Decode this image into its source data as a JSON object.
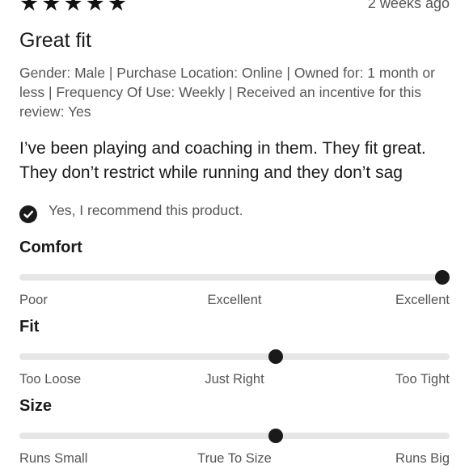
{
  "review": {
    "stars": [
      "★",
      "★",
      "★",
      "★",
      "★"
    ],
    "rating": 5,
    "date": "2 weeks ago",
    "title": "Great fit",
    "meta": "Gender: Male | Purchase Location: Online | Owned for: 1 month or less | Frequency Of Use: Weekly | Received an incentive for this review: Yes",
    "body_line1": "I’ve been playing and coaching in them. They fit great.",
    "body_line2": "They don’t restrict while running and they don’t sag",
    "recommend": "Yes, I recommend this product."
  },
  "factors": [
    {
      "name": "Comfort",
      "value": 1.0,
      "labels": [
        "Poor",
        "Excellent",
        "Excellent"
      ]
    },
    {
      "name": "Fit",
      "value": 0.6,
      "labels": [
        "Too Loose",
        "Just Right",
        "Too Tight"
      ]
    },
    {
      "name": "Size",
      "value": 0.6,
      "labels": [
        "Runs Small",
        "True To Size",
        "Runs Big"
      ]
    }
  ],
  "colors": {
    "accent": "#1a1a1a",
    "track": "#e6e6e6",
    "muted": "#555555"
  }
}
